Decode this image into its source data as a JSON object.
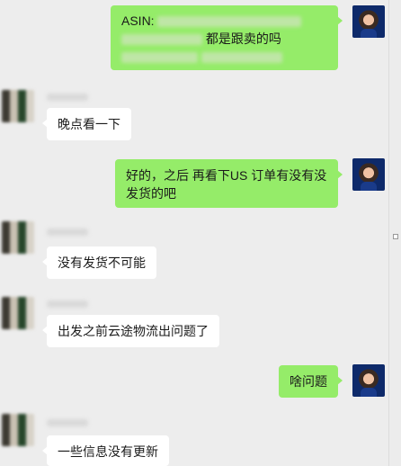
{
  "messages": [
    {
      "side": "self",
      "text": "ASIN:",
      "text2": "都是跟卖的吗"
    },
    {
      "side": "other",
      "text": "晚点看一下"
    },
    {
      "side": "self",
      "text": "好的，之后 再看下US 订单有没有没",
      "text2": "发货的吧"
    },
    {
      "side": "other",
      "text": "没有发货不可能"
    },
    {
      "side": "other",
      "text": "出发之前云途物流出问题了"
    },
    {
      "side": "self",
      "text": "啥问题"
    },
    {
      "side": "other",
      "text": "一些信息没有更新"
    }
  ]
}
